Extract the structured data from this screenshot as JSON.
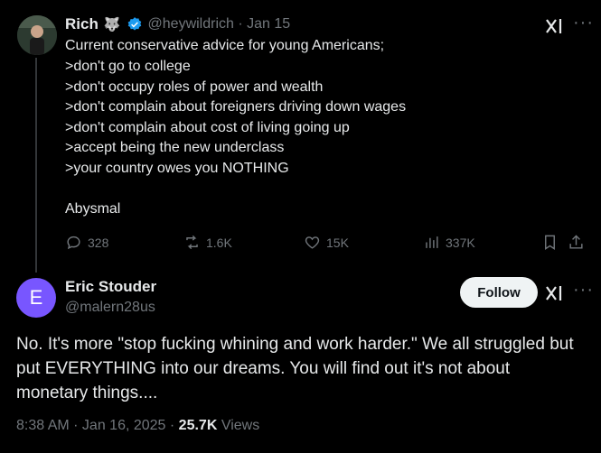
{
  "tweet": {
    "author_name": "Rich",
    "handle_time": "@heywildrich · Jan 15",
    "lines": [
      "Current conservative advice for young Americans;",
      ">don't go to college",
      ">don't occupy roles of power and wealth",
      ">don't complain about foreigners driving down wages",
      ">don't complain about cost of living going up",
      ">accept being the new underclass",
      ">your country owes you NOTHING",
      "",
      "Abysmal"
    ],
    "replies": "328",
    "reposts": "1.6K",
    "likes": "15K",
    "views": "337K"
  },
  "reply": {
    "avatar_letter": "E",
    "author_name": "Eric Stouder",
    "handle": "@malern28us",
    "follow_label": "Follow",
    "text": "No.  It's more \"stop fucking whining and work harder.\"  We all struggled but put EVERYTHING into our dreams.  You will find out it's not about monetary things....",
    "timestamp": "8:38 AM · Jan 16, 2025 · ",
    "views_count": "25.7K",
    "views_label": " Views"
  },
  "colors": {
    "background": "#000000",
    "text": "#e7e9ea",
    "muted": "#71767b",
    "verified": "#1d9bf0",
    "avatar_e": "#7856ff"
  }
}
